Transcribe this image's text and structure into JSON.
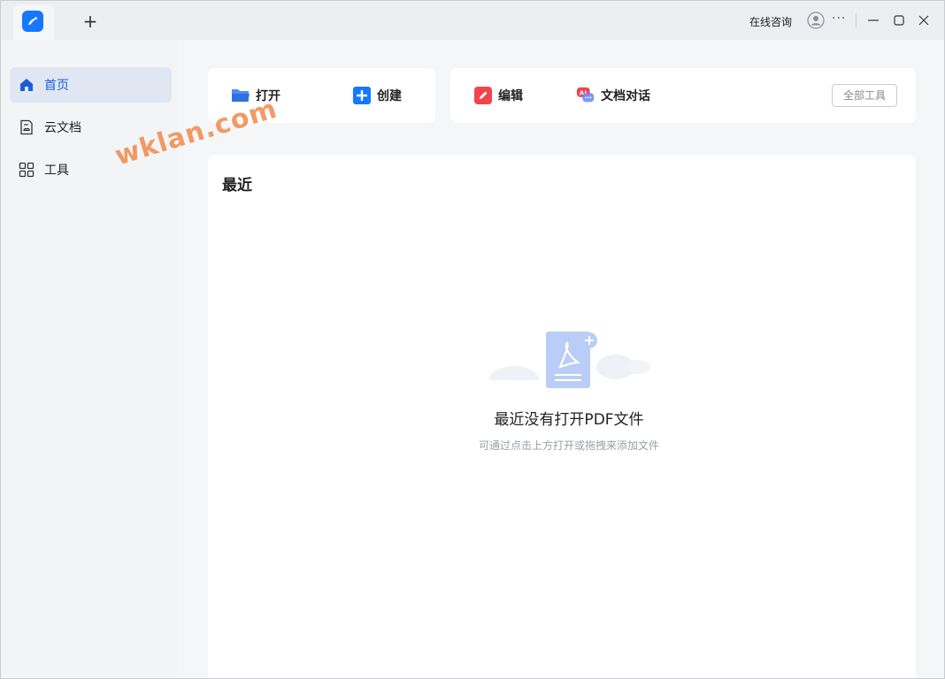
{
  "titlebar": {
    "new_tab": "+",
    "consult": "在线咨询",
    "more": "···"
  },
  "sidebar": {
    "items": [
      {
        "label": "首页",
        "icon": "home-icon"
      },
      {
        "label": "云文档",
        "icon": "cloud-doc-icon"
      },
      {
        "label": "工具",
        "icon": "grid-icon"
      }
    ]
  },
  "watermark": "wklan.com",
  "actions": {
    "open": "打开",
    "create": "创建",
    "edit": "编辑",
    "chat": "文档对话",
    "all_tools": "全部工具"
  },
  "recent": {
    "title": "最近",
    "empty_title": "最近没有打开PDF文件",
    "empty_sub": "可通过点击上方打开或拖拽来添加文件"
  },
  "colors": {
    "accent": "#1677ff",
    "active_bg": "#e0e7f3",
    "edit_red": "#f0454b",
    "watermark": "#f08a4b"
  }
}
